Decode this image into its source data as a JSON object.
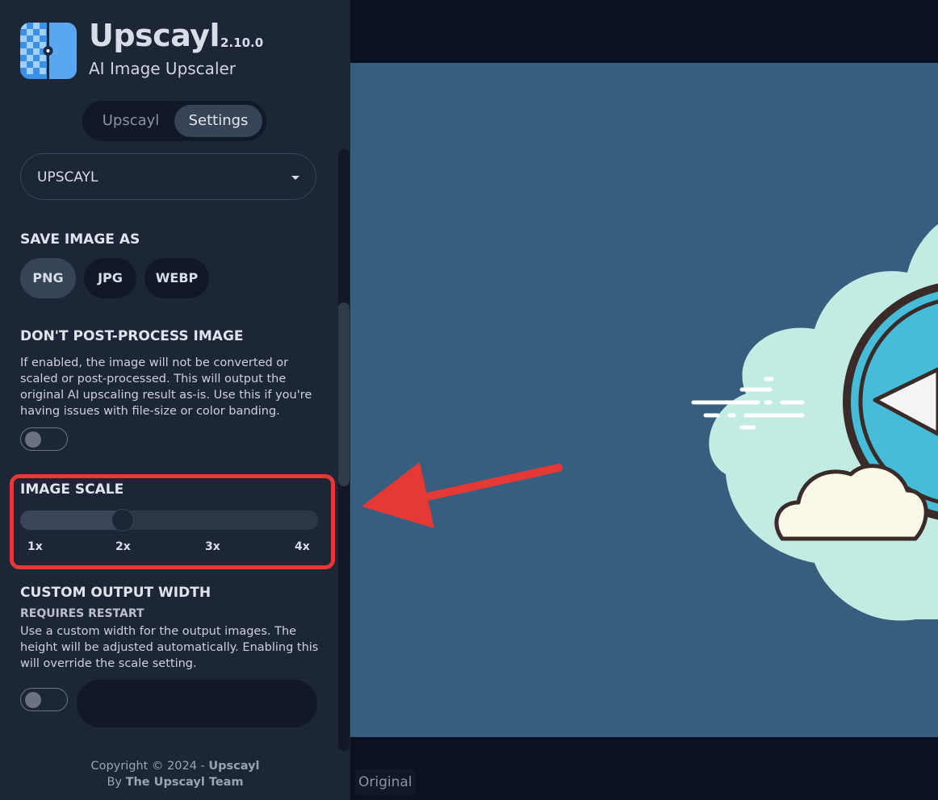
{
  "app": {
    "name": "Upscayl",
    "version": "2.10.0",
    "subtitle": "AI Image Upscaler"
  },
  "tabs": [
    {
      "label": "Upscayl",
      "active": false
    },
    {
      "label": "Settings",
      "active": true
    }
  ],
  "theme_select": {
    "value": "UPSCAYL"
  },
  "save_image_as": {
    "title": "SAVE IMAGE AS",
    "options": [
      "PNG",
      "JPG",
      "WEBP"
    ],
    "selected": "PNG"
  },
  "post_process": {
    "title": "DON'T POST-PROCESS IMAGE",
    "description": "If enabled, the image will not be converted or scaled or post-processed. This will output the original AI upscaling result as-is. Use this if you're having issues with file-size or color banding.",
    "enabled": false
  },
  "image_scale": {
    "title": "IMAGE SCALE",
    "ticks": [
      "1x",
      "2x",
      "3x",
      "4x"
    ],
    "value": 2,
    "min": 1,
    "max": 4
  },
  "custom_width": {
    "title": "CUSTOM OUTPUT WIDTH",
    "note": "REQUIRES RESTART",
    "description": "Use a custom width for the output images. The height will be adjusted automatically. Enabling this will override the scale setting.",
    "enabled": false,
    "value": ""
  },
  "footer": {
    "copyright_prefix": "Copyright © 2024 - ",
    "copyright_brand": "Upscayl",
    "by_prefix": "By ",
    "team": "The Upscayl Team"
  },
  "preview": {
    "label": "Original"
  },
  "colors": {
    "sidebar_bg": "#1d2636",
    "highlight": "#e53935",
    "preview_bg": "#375e7e"
  }
}
